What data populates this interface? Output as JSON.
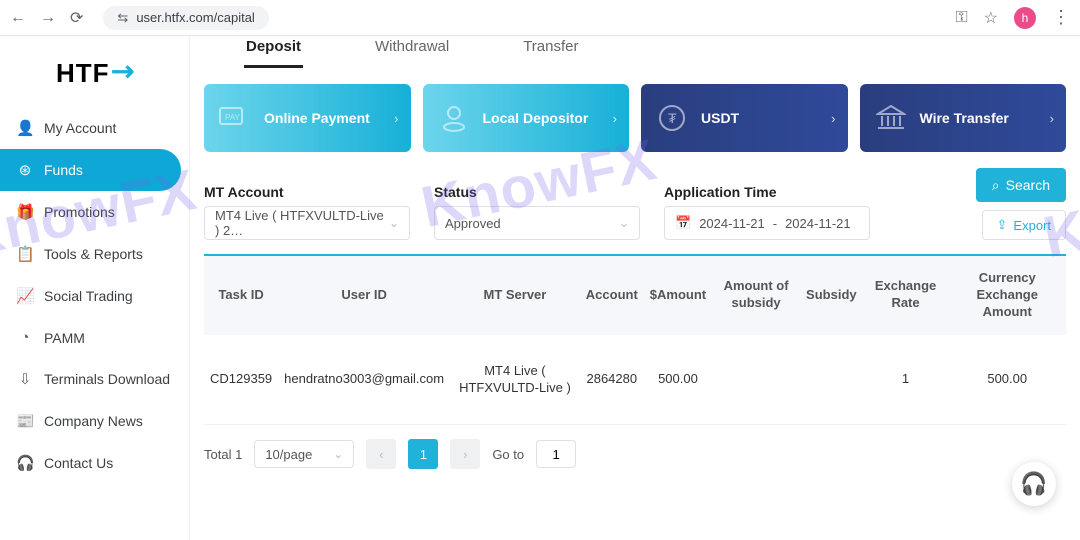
{
  "browser": {
    "url": "user.htfx.com/capital",
    "avatar_letter": "h"
  },
  "logo_text": "HTF",
  "sidebar": {
    "items": [
      {
        "label": "My Account",
        "icon": "👤"
      },
      {
        "label": "Funds",
        "icon": "⊛"
      },
      {
        "label": "Promotions",
        "icon": "🎁"
      },
      {
        "label": "Tools & Reports",
        "icon": "📋"
      },
      {
        "label": "Social Trading",
        "icon": "📈"
      },
      {
        "label": "PAMM",
        "icon": "◔"
      },
      {
        "label": "Terminals Download",
        "icon": "⇩"
      },
      {
        "label": "Company News",
        "icon": "📰"
      },
      {
        "label": "Contact Us",
        "icon": "🎧"
      }
    ]
  },
  "tabs": [
    "Deposit",
    "Withdrawal",
    "Transfer"
  ],
  "cards": [
    {
      "label": "Online Payment"
    },
    {
      "label": "Local Depositor"
    },
    {
      "label": "USDT"
    },
    {
      "label": "Wire Transfer"
    }
  ],
  "filters": {
    "mt_label": "MT Account",
    "mt_value": "MT4 Live ( HTFXVULTD-Live ) 2…",
    "status_label": "Status",
    "status_value": "Approved",
    "time_label": "Application Time",
    "date_from": "2024-11-21",
    "date_sep": "-",
    "date_to": "2024-11-21",
    "search_label": "Search",
    "export_label": "Export"
  },
  "table": {
    "headers": [
      "Task ID",
      "User ID",
      "MT Server",
      "Account",
      "$Amount",
      "Amount of subsidy",
      "Subsidy",
      "Exchange Rate",
      "Currency Exchange Amount"
    ],
    "rows": [
      {
        "task_id": "CD129359",
        "user_id": "hendratno3003@gmail.com",
        "mt_server": "MT4 Live ( HTFXVULTD-Live )",
        "account": "2864280",
        "amount": "500.00",
        "amount_subsidy": "",
        "subsidy": "",
        "exchange_rate": "1",
        "currency_exchange_amount": "500.00"
      }
    ]
  },
  "pager": {
    "total_label": "Total 1",
    "per_page": "10/page",
    "current": "1",
    "goto_label": "Go to",
    "goto_value": "1"
  },
  "watermark": "KnowFX"
}
